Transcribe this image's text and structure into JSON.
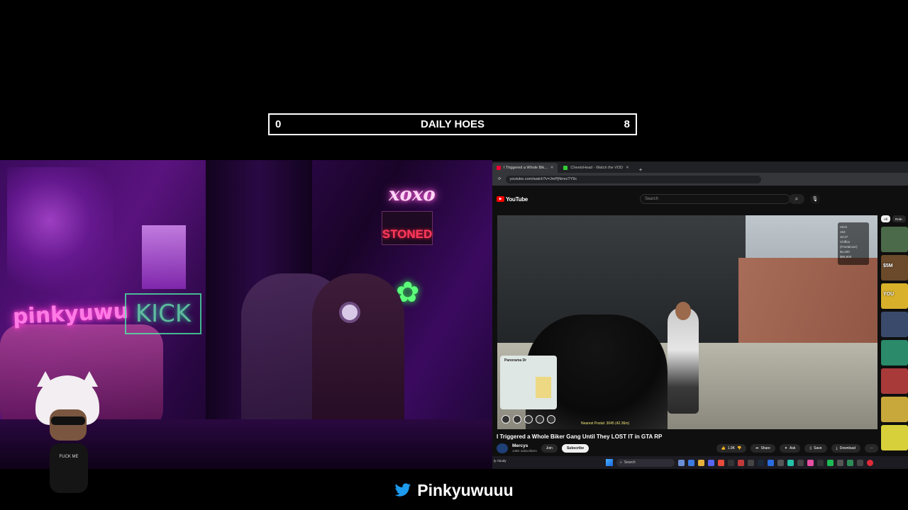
{
  "counter": {
    "left_value": "0",
    "title": "DAILY HOES",
    "right_value": "8"
  },
  "webcam": {
    "neon_signs": {
      "pink": "pinkyuwu",
      "green": "KICK",
      "xoxo": "xoxo",
      "stoned": "STONED",
      "leaf": "✿"
    },
    "avatar_shirt_text": "FUCK ME"
  },
  "browser": {
    "tabs": [
      {
        "label": "I Triggered a Whole Bik...",
        "active": true
      },
      {
        "label": "CheetoHead - Watch the VOD",
        "active": false
      }
    ],
    "new_tab": "+",
    "url": "youtube.com/watch?v=JmPjNmrzTY9c"
  },
  "youtube": {
    "logo_text": "YouTube",
    "search_placeholder": "Search",
    "video": {
      "minimap_label": "Panorama Dr",
      "postal": "Nearest Postal: 3045 (42.36m)",
      "overlay_lines": [
        "Hitch",
        "153",
        "10:37",
        "Chiffon (Freelancer)",
        "$4,200",
        "$65,900"
      ]
    },
    "title": "I Triggered a Whole Biker Gang Until They LOST IT in GTA RP",
    "channel": {
      "name": "Mercys",
      "subscribers": "146K subscribers"
    },
    "buttons": {
      "join": "Join",
      "subscribe": "Subscribe",
      "likes": "1.9K",
      "share": "Share",
      "ask": "Ask",
      "save": "Save",
      "download": "Download",
      "more": "···"
    },
    "chips": [
      {
        "label": "All",
        "active": true
      },
      {
        "label": "Role-",
        "active": false
      }
    ],
    "thumbnails": [
      {
        "caption": "",
        "color": "#4a6a4a"
      },
      {
        "caption": "$5M",
        "color": "#6a4a2a"
      },
      {
        "caption": "YOU",
        "color": "#d8b02a"
      },
      {
        "caption": "",
        "color": "#3a4a6a"
      },
      {
        "caption": "",
        "color": "#2a8a6a"
      },
      {
        "caption": "",
        "color": "#a83a3a"
      },
      {
        "caption": "",
        "color": "#c8a83a"
      },
      {
        "caption": "",
        "color": "#d8d03a"
      }
    ]
  },
  "taskbar": {
    "search_placeholder": "Search",
    "left_text": "ly cloudy"
  },
  "footer": {
    "handle": "Pinkyuwuuu"
  },
  "colors": {
    "youtube_red": "#ff0000",
    "twitter_blue": "#1d9bf0",
    "neon_pink": "#ff3fd2",
    "neon_green": "#2cff4c"
  }
}
